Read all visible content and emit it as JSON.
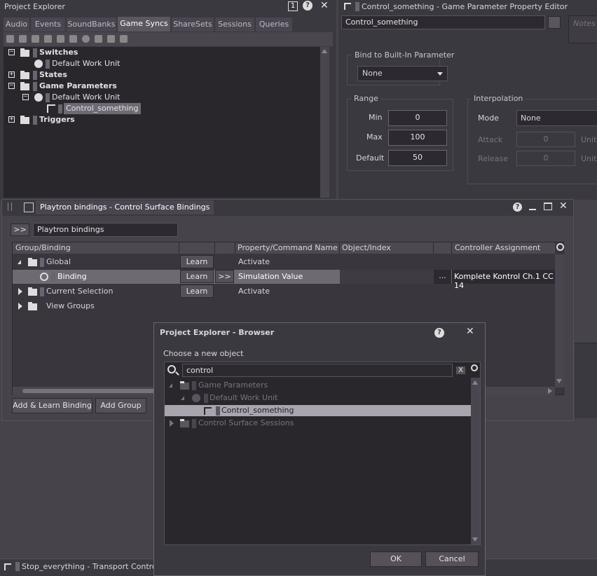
{
  "project_explorer": {
    "title": "Project Explorer",
    "badge": "1",
    "help": "?",
    "close": "✕",
    "tabs": [
      "Audio",
      "Events",
      "SoundBanks",
      "Game Syncs",
      "ShareSets",
      "Sessions",
      "Queries"
    ],
    "active_tab": "Game Syncs",
    "tree": [
      {
        "label": "Switches",
        "bold": true
      },
      {
        "label": "Default Work Unit",
        "bold": false
      },
      {
        "label": "States",
        "bold": true
      },
      {
        "label": "Game Parameters",
        "bold": true
      },
      {
        "label": "Default Work Unit",
        "bold": false
      },
      {
        "label": "Control_something",
        "bold": false
      },
      {
        "label": "Triggers",
        "bold": true
      }
    ]
  },
  "property_editor": {
    "title": "Control_something - Game Parameter Property Editor",
    "name_value": "Control_something",
    "notes_placeholder": "Notes",
    "bind_label": "Bind to Built-In Parameter",
    "bind_value": "None",
    "range_label": "Range",
    "min_label": "Min",
    "min_value": "0",
    "max_label": "Max",
    "max_value": "100",
    "default_label": "Default",
    "default_value": "50",
    "interp_label": "Interpolation",
    "mode_label": "Mode",
    "mode_value": "None",
    "attack_label": "Attack",
    "attack_value": "0",
    "attack_unit": "Units",
    "release_label": "Release",
    "release_value": "0",
    "release_unit": "Units"
  },
  "bindings": {
    "title": "Playtron bindings - Control Surface Bindings",
    "expand_btn": ">>",
    "name_value": "Playtron bindings",
    "columns": [
      "Group/Binding",
      "Property/Command Name",
      "Object/Index",
      "Controller Assignment"
    ],
    "rows": [
      {
        "name": "Global",
        "learn": "Learn",
        "property": "Activate",
        "controller": ""
      },
      {
        "name": "Binding",
        "learn": "Learn",
        "arrow": ">>",
        "property": "Simulation Value",
        "more": "...",
        "controller": "Komplete Kontrol Ch.1 CC 14"
      },
      {
        "name": "Current Selection",
        "learn": "Learn",
        "property": "Activate",
        "controller": ""
      },
      {
        "name": "View Groups",
        "learn": "",
        "property": "",
        "controller": ""
      }
    ],
    "add_learn_btn": "Add & Learn Binding",
    "add_group_btn": "Add Group"
  },
  "browser": {
    "title": "Project Explorer - Browser",
    "help": "?",
    "close": "✕",
    "prompt": "Choose a new object",
    "search_value": "control",
    "clear_btn": "X",
    "tree": [
      {
        "label": "Game Parameters",
        "dim": true
      },
      {
        "label": "Default Work Unit",
        "dim": true
      },
      {
        "label": "Control_something",
        "dim": false
      },
      {
        "label": "Control Surface Sessions",
        "dim": true
      }
    ],
    "ok_btn": "OK",
    "cancel_btn": "Cancel"
  },
  "transport": {
    "title": "Stop_everything - Transport Control"
  }
}
